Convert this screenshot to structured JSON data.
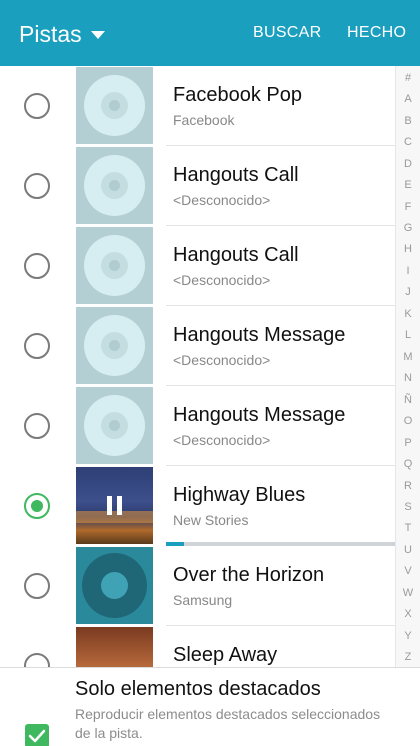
{
  "header": {
    "title": "Pistas",
    "search_label": "BUSCAR",
    "done_label": "HECHO",
    "color": "#1a9fbf"
  },
  "tracks": [
    {
      "title": "Facebook Pop",
      "subtitle": "Facebook",
      "selected": false,
      "art": "disc"
    },
    {
      "title": "Hangouts Call",
      "subtitle": "<Desconocido>",
      "selected": false,
      "art": "disc"
    },
    {
      "title": "Hangouts Call",
      "subtitle": "<Desconocido>",
      "selected": false,
      "art": "disc"
    },
    {
      "title": "Hangouts Message",
      "subtitle": "<Desconocido>",
      "selected": false,
      "art": "disc"
    },
    {
      "title": "Hangouts Message",
      "subtitle": "<Desconocido>",
      "selected": false,
      "art": "disc"
    },
    {
      "title": "Highway Blues",
      "subtitle": "New Stories",
      "selected": true,
      "art": "blues",
      "playing": true,
      "progress_fraction": 0.08
    },
    {
      "title": "Over the Horizon",
      "subtitle": "Samsung",
      "selected": false,
      "art": "horizon"
    },
    {
      "title": "Sleep Away",
      "subtitle": "",
      "selected": false,
      "art": "sleep"
    }
  ],
  "index_letters": [
    "#",
    "A",
    "B",
    "C",
    "D",
    "E",
    "F",
    "G",
    "H",
    "I",
    "J",
    "K",
    "L",
    "M",
    "N",
    "Ñ",
    "O",
    "P",
    "Q",
    "R",
    "S",
    "T",
    "U",
    "V",
    "W",
    "X",
    "Y",
    "Z"
  ],
  "footer": {
    "checkbox_checked": true,
    "title": "Solo elementos destacados",
    "description": "Reproducir elementos destacados seleccionados de la pista."
  },
  "icons": {
    "title_dropdown": "caret-down-icon",
    "selected_radio": "radio-checked-icon",
    "unselected_radio": "radio-unchecked-icon",
    "pause": "pause-icon",
    "checkbox": "checkbox-checked-icon"
  },
  "colors": {
    "accent": "#1a9fbf",
    "selection": "#3fb85f"
  }
}
